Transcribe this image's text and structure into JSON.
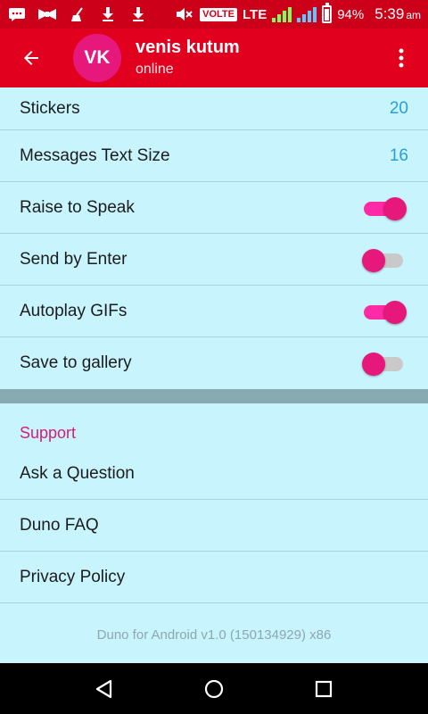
{
  "status_bar": {
    "volte": "VOLTE",
    "lte": "LTE",
    "battery": "94%",
    "time": "5:39",
    "ampm": "am"
  },
  "app_bar": {
    "avatar_initials": "VK",
    "title": "venis kutum",
    "subtitle": "online"
  },
  "settings": {
    "stickers": {
      "label": "Stickers",
      "value": "20"
    },
    "text_size": {
      "label": "Messages Text Size",
      "value": "16"
    },
    "raise_to_speak": {
      "label": "Raise to Speak",
      "on": true
    },
    "send_by_enter": {
      "label": "Send by Enter",
      "on": false
    },
    "autoplay_gifs": {
      "label": "Autoplay GIFs",
      "on": true
    },
    "save_to_gallery": {
      "label": "Save to gallery",
      "on": false
    }
  },
  "support": {
    "header": "Support",
    "items": [
      "Ask a Question",
      "Duno FAQ",
      "Privacy Policy"
    ]
  },
  "version": "Duno for Android v1.0 (150134929) x86",
  "colors": {
    "primary": "#e2001f",
    "accent": "#e6187c",
    "background": "#c8f4fd",
    "value_text": "#2a9fd6"
  }
}
